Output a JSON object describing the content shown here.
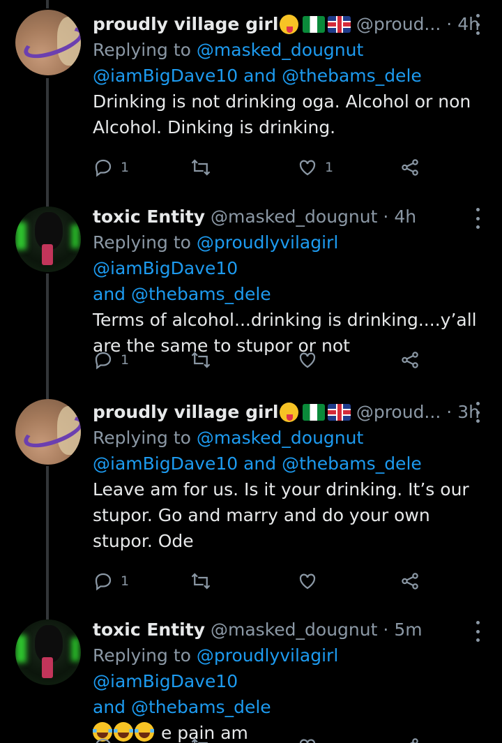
{
  "tweets": [
    {
      "name": "proudly village girl",
      "handle": "@proud...",
      "time": "4h",
      "reply_prefix": "Replying to ",
      "mentions_line1": "@masked_dougnut",
      "mentions_line2a": "@iamBigDave10",
      "and": " and ",
      "mentions_line2b": "@thebams_dele",
      "text_lines": [
        "Drinking is not drinking oga. Alcohol or non",
        "Alcohol. Dinking is drinking."
      ],
      "reply_count": "1",
      "like_count": "1"
    },
    {
      "name": "toxic Entity",
      "handle": "@masked_dougnut",
      "time": "4h",
      "reply_prefix": "Replying to ",
      "mentions_line1a": "@proudlyvilagirl",
      "mentions_line1b": "@iamBigDave10",
      "and": "and ",
      "mentions_line2": "@thebams_dele",
      "text_lines": [
        "Terms of alcohol...drinking is drinking....y’all",
        "are the same to stupor or not"
      ],
      "reply_count": "1",
      "like_count": ""
    },
    {
      "name": "proudly village girl",
      "handle": "@proud...",
      "time": "3h",
      "reply_prefix": "Replying to ",
      "mentions_line1": "@masked_dougnut",
      "mentions_line2a": "@iamBigDave10",
      "and": " and ",
      "mentions_line2b": "@thebams_dele",
      "text_lines": [
        "Leave am for us. Is it your drinking. It’s our",
        "stupor. Go and marry and do your own",
        "stupor. Ode"
      ],
      "reply_count": "1",
      "like_count": ""
    },
    {
      "name": "toxic Entity",
      "handle": "@masked_dougnut",
      "time": "5m",
      "reply_prefix": "Replying to ",
      "mentions_line1a": "@proudlyvilagirl",
      "mentions_line1b": "@iamBigDave10",
      "and": "and ",
      "mentions_line2": "@thebams_dele",
      "text_after_emoji": " e pain am",
      "emoji": [
        "joy-emoji",
        "joy-emoji",
        "joy-emoji"
      ]
    }
  ],
  "colors": {
    "background": "#000000",
    "text": "#e7e9ea",
    "muted": "#8b98a5",
    "link": "#1d9bf0",
    "thread_line": "#333639"
  },
  "icons": [
    "reply-icon",
    "retweet-icon",
    "like-icon",
    "share-icon",
    "more-icon",
    "tongue-emoji",
    "nigeria-flag",
    "uk-flag"
  ]
}
